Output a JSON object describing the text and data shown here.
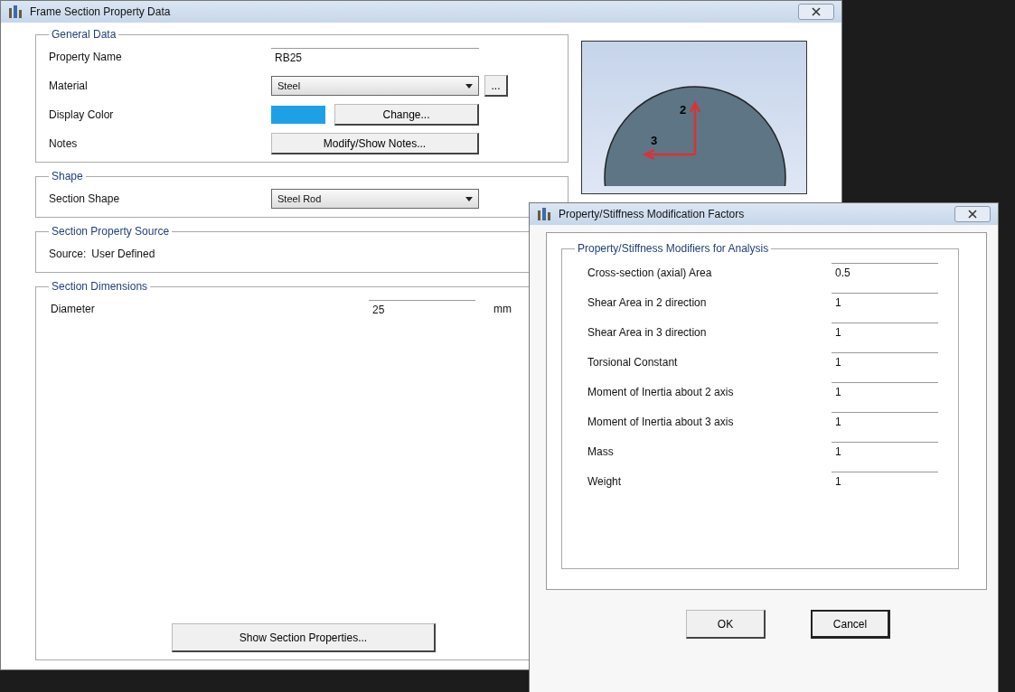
{
  "window": {
    "title": "Frame Section Property Data"
  },
  "general_data": {
    "title": "General Data",
    "property_name": {
      "label": "Property Name",
      "value": "RB25"
    },
    "material": {
      "label": "Material",
      "value": "Steel",
      "more": "..."
    },
    "display_color": {
      "label": "Display Color",
      "color": "#1ea0e6",
      "button": "Change..."
    },
    "notes": {
      "label": "Notes",
      "button": "Modify/Show Notes..."
    }
  },
  "shape": {
    "title": "Shape",
    "label": "Section Shape",
    "value": "Steel Rod"
  },
  "source": {
    "title": "Section Property Source",
    "label": "Source:",
    "value": "User Defined"
  },
  "dimensions": {
    "title": "Section Dimensions",
    "label": "Diameter",
    "value": "25",
    "unit": "mm",
    "button": "Show Section Properties..."
  },
  "preview": {
    "axis_vertical": "2",
    "axis_horizontal": "3"
  },
  "modifiers_dialog": {
    "title": "Property/Stiffness Modification Factors",
    "group_title": "Property/Stiffness Modifiers for Analysis",
    "rows": [
      {
        "label": "Cross-section (axial) Area",
        "value": "0.5"
      },
      {
        "label": "Shear Area in 2 direction",
        "value": "1"
      },
      {
        "label": "Shear Area in 3 direction",
        "value": "1"
      },
      {
        "label": "Torsional Constant",
        "value": "1"
      },
      {
        "label": "Moment of Inertia about 2 axis",
        "value": "1"
      },
      {
        "label": "Moment of Inertia about 3 axis",
        "value": "1"
      },
      {
        "label": "Mass",
        "value": "1"
      },
      {
        "label": "Weight",
        "value": "1"
      }
    ],
    "buttons": [
      {
        "label": "OK",
        "focused": false
      },
      {
        "label": "Cancel",
        "focused": true
      }
    ]
  }
}
